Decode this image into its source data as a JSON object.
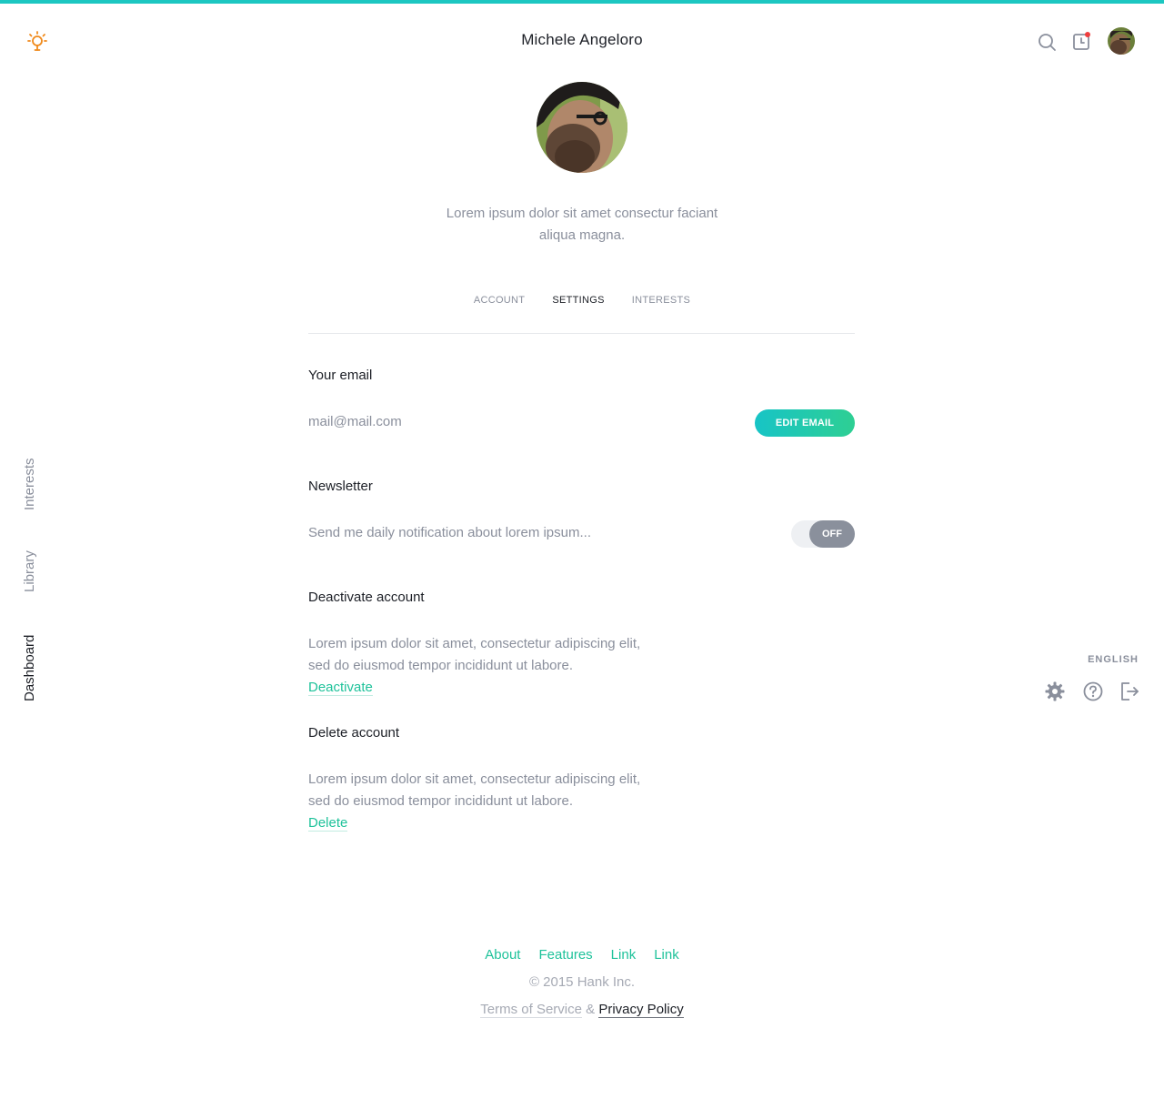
{
  "colors": {
    "accent": "#1cc7c1",
    "link": "#1ec29a",
    "muted": "#8a8f9c",
    "notification_dot": "#ef3d3d",
    "logo": "#f08a1c"
  },
  "header": {
    "title": "Michele Angeloro",
    "icons": [
      "lightbulb-logo-icon",
      "search-icon",
      "notification-icon",
      "avatar"
    ]
  },
  "profile": {
    "bio": "Lorem ipsum dolor sit amet consectur faciant aliqua magna."
  },
  "tabs": [
    {
      "label": "ACCOUNT",
      "active": false
    },
    {
      "label": "SETTINGS",
      "active": true
    },
    {
      "label": "INTERESTS",
      "active": false
    }
  ],
  "email_section": {
    "title": "Your email",
    "value": "mail@mail.com",
    "button": "EDIT EMAIL"
  },
  "newsletter": {
    "title": "Newsletter",
    "description": "Send me daily notification about lorem ipsum...",
    "toggle_state": "OFF"
  },
  "deactivate": {
    "title": "Deactivate account",
    "line1": "Lorem ipsum dolor sit amet, consectetur adipiscing elit,",
    "line2": "sed do eiusmod tempor incididunt ut labore.",
    "link": "Deactivate"
  },
  "delete": {
    "title": "Delete account",
    "line1": "Lorem ipsum dolor sit amet, consectetur adipiscing elit,",
    "line2": "sed do eiusmod tempor incididunt ut labore.",
    "link": "Delete"
  },
  "side_nav": [
    {
      "label": "Interests",
      "active": false
    },
    {
      "label": "Library",
      "active": false
    },
    {
      "label": "Dashboard",
      "active": true
    }
  ],
  "right_panel": {
    "language": "ENGLISH",
    "icons": [
      "gear-icon",
      "help-icon",
      "logout-icon"
    ]
  },
  "footer": {
    "links": [
      "About",
      "Features",
      "Link",
      "Link"
    ],
    "copyright": "© 2015 Hank Inc.",
    "terms": "Terms of Service",
    "separator": "&",
    "privacy": "Privacy Policy"
  }
}
